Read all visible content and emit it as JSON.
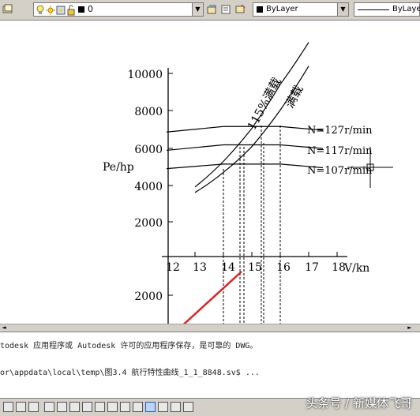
{
  "toolbar": {
    "layer_name": "0",
    "color_value": "ByLayer",
    "linetype_value": "ByLayer",
    "icons": [
      "layers-icon",
      "bulb-icon",
      "sun-icon",
      "lock-icon",
      "color-square-icon",
      "layer-previous-icon",
      "layer-state-icon",
      "layer-match-icon"
    ]
  },
  "chart": {
    "ylabel": "Pe/hp",
    "xlabel": "V/kn",
    "curve_labels": {
      "overload": "115%满载",
      "full_load": "满载",
      "n127": "N=127r/min",
      "n117": "N=117r/min",
      "n107": "N=107r/min"
    }
  },
  "chart_data": {
    "type": "line",
    "xlabel": "V/kn",
    "ylabel": "Pe/hp",
    "x_ticks": [
      "12",
      "13",
      "14",
      "15",
      "16",
      "17",
      "18"
    ],
    "y_ticks_upper": [
      "10000",
      "8000",
      "6000",
      "4000",
      "2000"
    ],
    "y_ticks_lower": [
      "2000"
    ],
    "series": [
      {
        "name": "115%满载",
        "x": [
          13,
          14,
          15,
          16,
          17
        ],
        "y": [
          3800,
          5200,
          7000,
          9400,
          11700
        ]
      },
      {
        "name": "满载",
        "x": [
          13,
          14,
          15,
          16,
          17
        ],
        "y": [
          3500,
          4600,
          6000,
          8000,
          10400
        ]
      },
      {
        "name": "N=127r/min",
        "x": [
          12,
          14,
          16,
          17.5
        ],
        "y": [
          6800,
          7100,
          7100,
          6900
        ]
      },
      {
        "name": "N=117r/min",
        "x": [
          12,
          14,
          16,
          17.5
        ],
        "y": [
          5800,
          6100,
          6100,
          5900
        ]
      },
      {
        "name": "N=107r/min",
        "x": [
          12,
          14,
          16,
          17.5
        ],
        "y": [
          4800,
          5050,
          5050,
          4850
        ]
      }
    ]
  },
  "command_line": {
    "line1": "todesk 应用程序或 Autodesk 许可的应用程序保存，是可靠的 DWG。",
    "line2": "or\\appdata\\local\\temp\\图3.4 航行特性曲线_1_1_8848.sv$ ..."
  },
  "watermark": "头条号 / 新媒体飞哥",
  "colors": {
    "toolbar_bg": "#d4d0c8",
    "arrow": "#e02020"
  }
}
